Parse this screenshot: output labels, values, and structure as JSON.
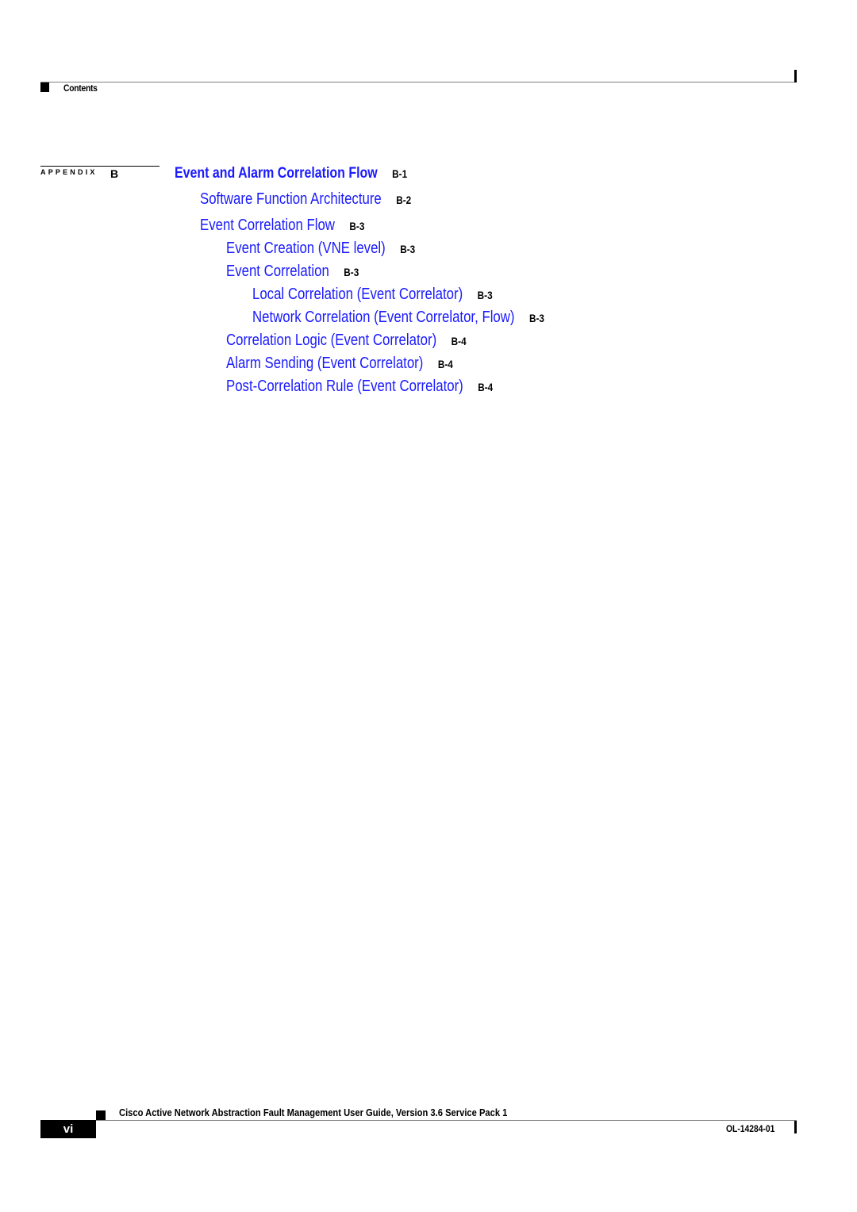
{
  "header": {
    "section_title": "Contents"
  },
  "appendix": {
    "label": "APPENDIX",
    "letter": "B"
  },
  "toc": {
    "link_color": "#1a1aff",
    "entries": [
      {
        "level": 0,
        "title": "Event and Alarm Correlation Flow",
        "page": "B-1"
      },
      {
        "level": 1,
        "title": "Software Function Architecture",
        "page": "B-2"
      },
      {
        "level": 1,
        "title": "Event Correlation Flow",
        "page": "B-3"
      },
      {
        "level": 2,
        "title": "Event Creation (VNE level)",
        "page": "B-3"
      },
      {
        "level": 2,
        "title": "Event Correlation",
        "page": "B-3"
      },
      {
        "level": 3,
        "title": "Local Correlation (Event Correlator)",
        "page": "B-3"
      },
      {
        "level": 3,
        "title": "Network Correlation (Event Correlator, Flow)",
        "page": "B-3"
      },
      {
        "level": 2,
        "title": "Correlation Logic (Event Correlator)",
        "page": "B-4"
      },
      {
        "level": 2,
        "title": "Alarm Sending (Event Correlator)",
        "page": "B-4"
      },
      {
        "level": 2,
        "title": "Post-Correlation Rule (Event Correlator)",
        "page": "B-4"
      }
    ]
  },
  "footer": {
    "doc_title": "Cisco Active Network Abstraction Fault Management User Guide, Version 3.6 Service Pack 1",
    "page_number": "vi",
    "doc_number": "OL-14284-01"
  }
}
